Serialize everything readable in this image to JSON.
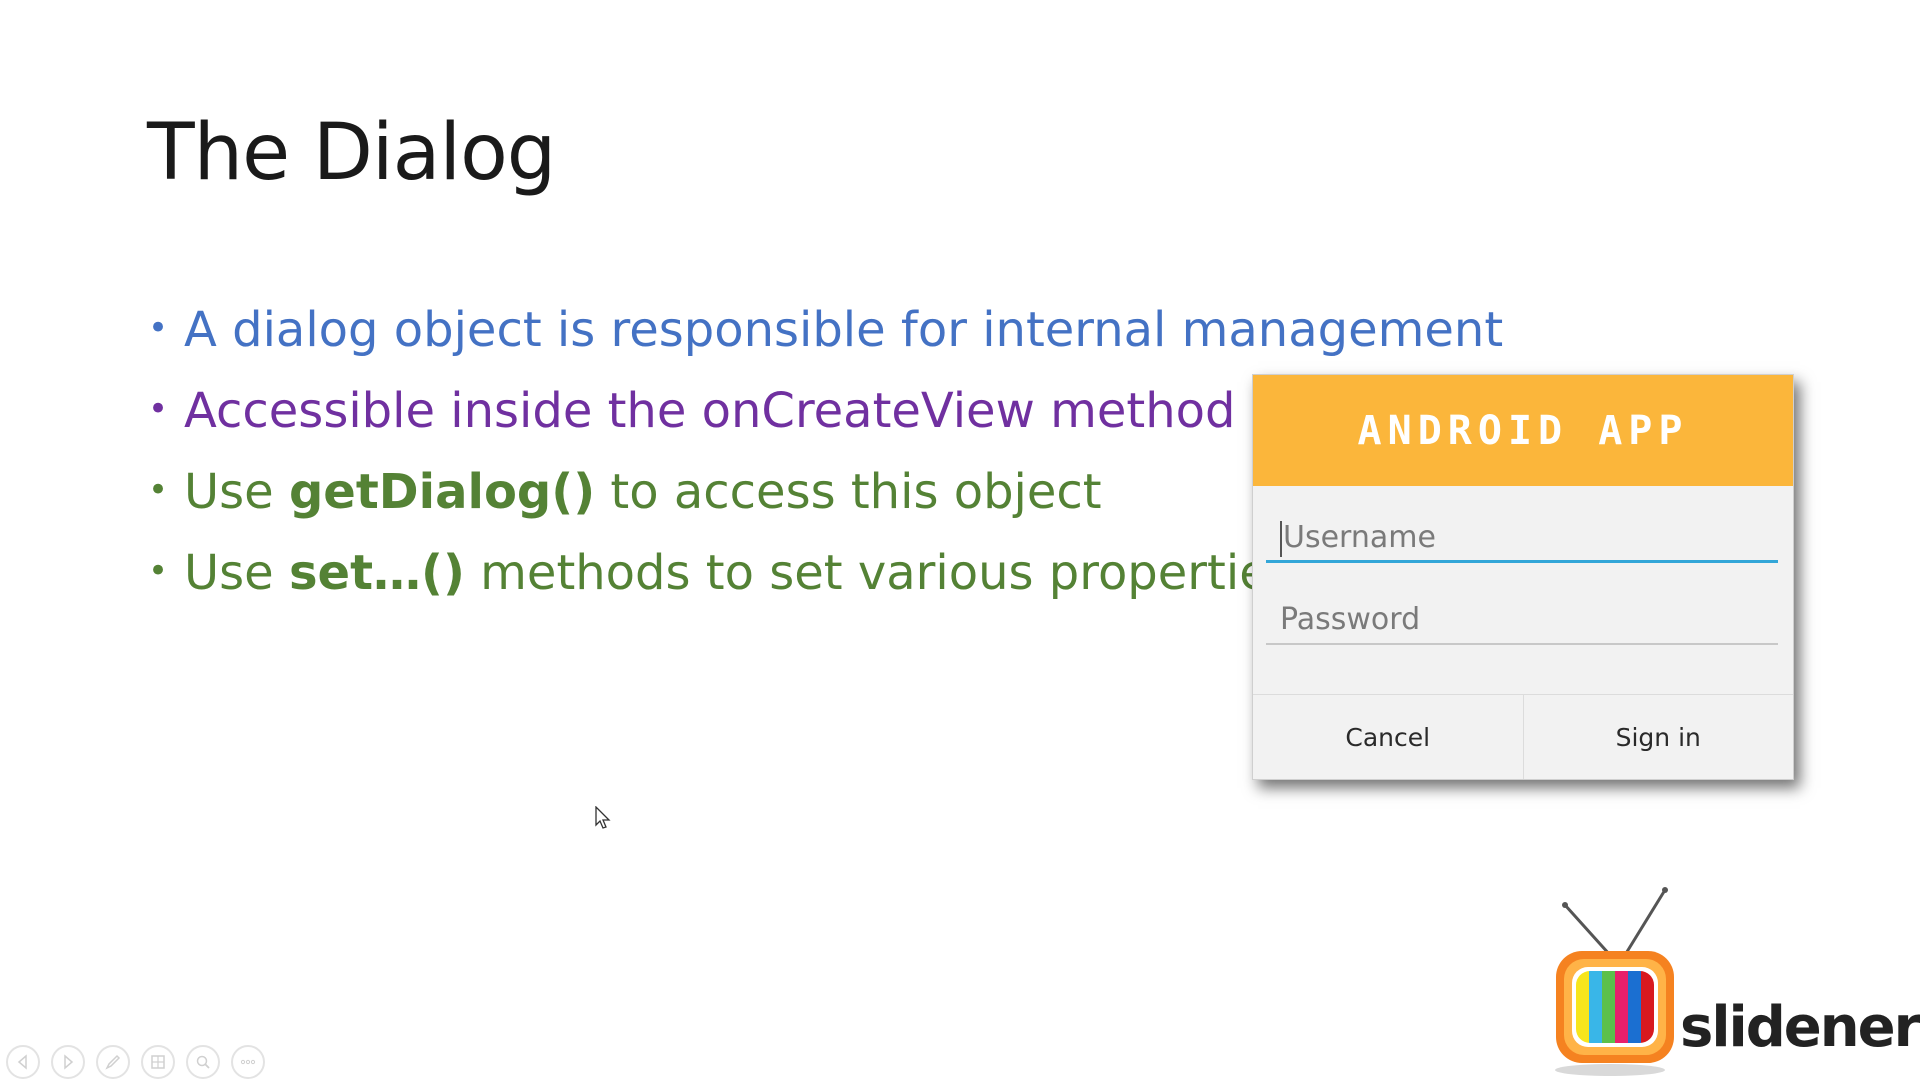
{
  "slide": {
    "title": "The Dialog",
    "bullets": [
      {
        "text": "A dialog object is responsible for internal management",
        "color": "#4472c4"
      },
      {
        "text": "Accessible inside the onCreateView method",
        "color": "#7030a0"
      },
      {
        "pre": "Use ",
        "bold": "getDialog()",
        "post": " to access this object",
        "color": "#548235"
      },
      {
        "pre": "Use ",
        "bold": "set…()",
        "post": " methods to set various properties",
        "color": "#548235"
      }
    ],
    "bullet_glyph": "•"
  },
  "dialog_image": {
    "header": "ANDROID APP",
    "header_color": "#fbb63b",
    "username_placeholder": "Username",
    "password_placeholder": "Password",
    "cancel_label": "Cancel",
    "signin_label": "Sign in"
  },
  "logo": {
    "text": "slidenerd"
  },
  "toolbar": {
    "buttons": [
      "previous-icon",
      "next-icon",
      "pen-icon",
      "slides-icon",
      "zoom-icon",
      "more-icon"
    ]
  }
}
